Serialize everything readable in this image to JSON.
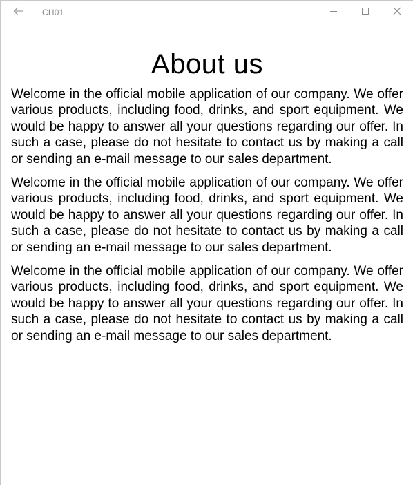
{
  "window": {
    "title": "CH01",
    "back_icon": "arrow-left-icon",
    "minimize_icon": "minimize-icon",
    "maximize_icon": "maximize-icon",
    "close_icon": "close-icon"
  },
  "page": {
    "heading": "About us",
    "paragraphs": [
      "Welcome in the official mobile application of our company. We offer various products, including food, drinks, and sport equipment. We would be happy to answer all your questions regarding our offer. In such a case, please do not hesitate to contact us by making a call or sending an e-mail message to our sales department.",
      "Welcome in the official mobile application of our company. We offer various products, including food, drinks, and sport equipment. We would be happy to answer all your questions regarding our offer. In such a case, please do not hesitate to contact us by making a call or sending an e-mail message to our sales department.",
      "Welcome in the official mobile application of our company. We offer various products, including food, drinks, and sport equipment. We would be happy to answer all your questions regarding our offer. In such a case, please do not hesitate to contact us by making a call or sending an e-mail message to our sales department."
    ]
  },
  "colors": {
    "title_text": "#8a8a8a",
    "icon": "#8a8a8a",
    "body_text": "#000000",
    "background": "#ffffff"
  }
}
